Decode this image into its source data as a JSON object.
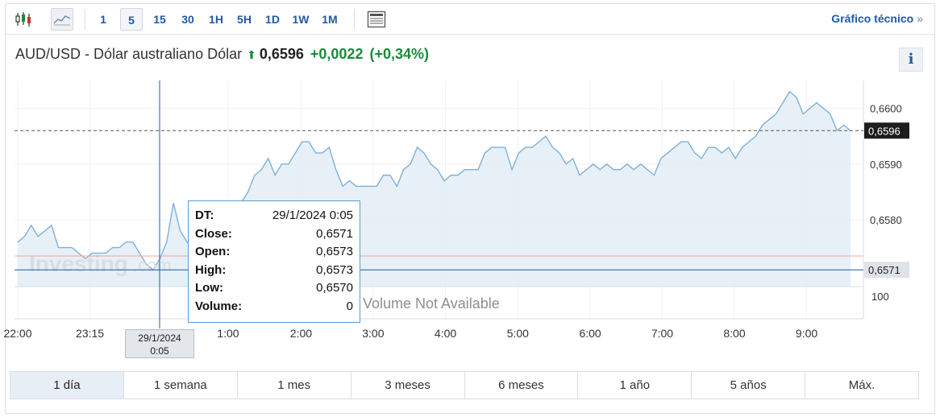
{
  "toolbar": {
    "timeframes": [
      "1",
      "5",
      "15",
      "30",
      "1H",
      "5H",
      "1D",
      "1W",
      "1M"
    ],
    "selected_timeframe": "5",
    "icons": [
      "candlestick-icon",
      "area-chart-icon",
      "news-icon"
    ],
    "technical_link": "Gráfico técnico",
    "technical_chevron": "»"
  },
  "header": {
    "title": "AUD/USD - Dólar australiano Dólar",
    "direction": "up",
    "price": "0,6596",
    "change": "+0,0022",
    "change_pct": "(+0,34%)",
    "info_label": "i"
  },
  "tooltip": {
    "rows": [
      {
        "key": "DT:",
        "value": "29/1/2024 0:05"
      },
      {
        "key": "Close:",
        "value": "0,6571"
      },
      {
        "key": "Open:",
        "value": "0,6573"
      },
      {
        "key": "High:",
        "value": "0,6573"
      },
      {
        "key": "Low:",
        "value": "0,6570"
      },
      {
        "key": "Volume:",
        "value": "0"
      }
    ]
  },
  "crosshair_time": {
    "line1": "29/1/2024",
    "line2": "0:05"
  },
  "ranges": [
    "1 día",
    "1 semana",
    "1 mes",
    "3 meses",
    "6 meses",
    "1 año",
    "5 años",
    "Máx."
  ],
  "selected_range": "1 día",
  "colors": {
    "accent": "#1f5aa6",
    "up": "#1a8a3a",
    "line": "#7fb0d9",
    "fill": "#e3edf5"
  },
  "chart_data": {
    "type": "area",
    "series": [
      {
        "values": [
          0.6576,
          0.6577,
          0.6579,
          0.6577,
          0.6578,
          0.6579,
          0.6575,
          0.6575,
          0.6575,
          0.6574,
          0.6573,
          0.6574,
          0.6574,
          0.6574,
          0.6575,
          0.6575,
          0.6576,
          0.6576,
          0.6574,
          0.6572,
          0.6571,
          0.6573,
          0.6576,
          0.6583,
          0.6578,
          0.6576,
          0.6575,
          0.6578,
          0.6579,
          0.658,
          0.6578,
          0.6578,
          0.6579,
          0.6583,
          0.6585,
          0.6588,
          0.6589,
          0.6591,
          0.6588,
          0.659,
          0.659,
          0.6592,
          0.6594,
          0.6594,
          0.6592,
          0.6592,
          0.6593,
          0.6589,
          0.6586,
          0.6587,
          0.6586,
          0.6586,
          0.6586,
          0.6586,
          0.6588,
          0.6588,
          0.6586,
          0.6589,
          0.659,
          0.6593,
          0.6592,
          0.659,
          0.6589,
          0.6587,
          0.6588,
          0.6588,
          0.6589,
          0.6589,
          0.6589,
          0.6592,
          0.6593,
          0.6593,
          0.6593,
          0.6589,
          0.6592,
          0.6593,
          0.6593,
          0.6594,
          0.6595,
          0.6593,
          0.6592,
          0.659,
          0.6591,
          0.6588,
          0.6589,
          0.659,
          0.6589,
          0.659,
          0.6589,
          0.6589,
          0.659,
          0.6589,
          0.659,
          0.6589,
          0.6588,
          0.6591,
          0.6592,
          0.6593,
          0.6594,
          0.6594,
          0.6592,
          0.6591,
          0.6593,
          0.6593,
          0.6592,
          0.6593,
          0.6591,
          0.6593,
          0.6594,
          0.6595,
          0.6597,
          0.6598,
          0.6599,
          0.6601,
          0.6603,
          0.6602,
          0.6599,
          0.66,
          0.6601,
          0.66,
          0.6599,
          0.6596,
          0.6597,
          0.6596
        ]
      }
    ],
    "x_tick_labels": [
      "22:00",
      "23:15",
      "1:00",
      "2:00",
      "3:00",
      "4:00",
      "5:00",
      "6:00",
      "7:00",
      "8:00",
      "9:00"
    ],
    "y_tick_labels": [
      "0,6600",
      "0,6590",
      "0,6580"
    ],
    "ylim": [
      0.6568,
      0.6605
    ],
    "last_price_label": "0,6596",
    "crosshair_price_label": "0,6571",
    "volume_axis_label": "100",
    "volume_note": "Volume Not Available",
    "watermark": "Investing.com",
    "grid": true
  }
}
